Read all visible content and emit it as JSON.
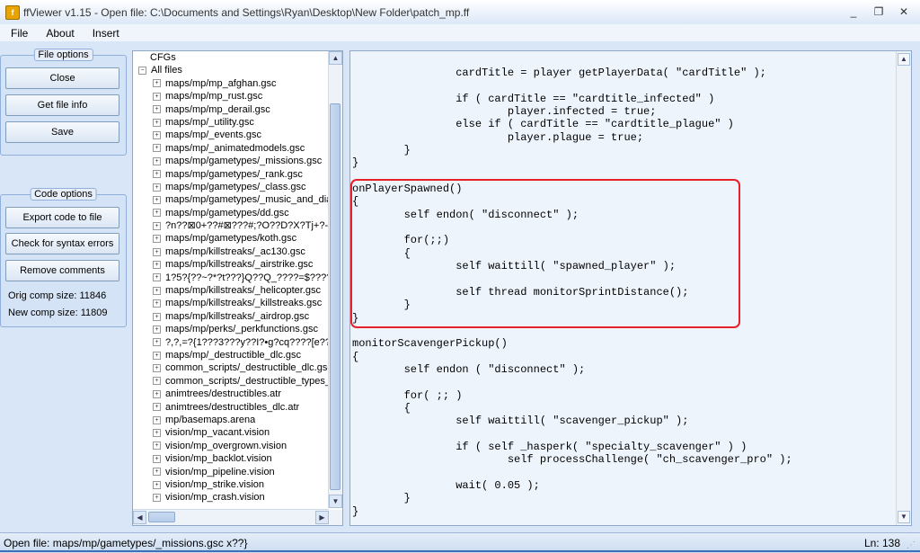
{
  "window": {
    "title": "ffViewer v1.15 - Open file: C:\\Documents and Settings\\Ryan\\Desktop\\New Folder\\patch_mp.ff",
    "minimize": "_",
    "restore": "❐",
    "close": "✕"
  },
  "menu": [
    "File",
    "About",
    "Insert"
  ],
  "file_options": {
    "title": "File options",
    "close": "Close",
    "get_info": "Get file info",
    "save": "Save"
  },
  "code_options": {
    "title": "Code options",
    "export": "Export code to file",
    "syntax": "Check for syntax errors",
    "remove_comments": "Remove comments",
    "orig_size": "Orig comp size: 11846",
    "new_size": "New comp size: 11809"
  },
  "tree": {
    "cfgs": "CFGs",
    "all_files": "All files",
    "items": [
      "maps/mp/mp_afghan.gsc",
      "maps/mp/mp_rust.gsc",
      "maps/mp/mp_derail.gsc",
      "maps/mp/_utility.gsc",
      "maps/mp/_events.gsc",
      "maps/mp/_animatedmodels.gsc",
      "maps/mp/gametypes/_missions.gsc",
      "maps/mp/gametypes/_rank.gsc",
      "maps/mp/gametypes/_class.gsc",
      "maps/mp/gametypes/_music_and_dia",
      "maps/mp/gametypes/dd.gsc",
      "?n??⊠0+??#⊠???#;?O??D?X?Tj+?-?k",
      "maps/mp/gametypes/koth.gsc",
      "maps/mp/killstreaks/_ac130.gsc",
      "maps/mp/killstreaks/_airstrike.gsc",
      "1?5?{??~?*?t???}Q??Q_????=$????",
      "maps/mp/killstreaks/_helicopter.gsc",
      "maps/mp/killstreaks/_killstreaks.gsc",
      "maps/mp/killstreaks/_airdrop.gsc",
      "maps/mp/perks/_perkfunctions.gsc",
      "?,?,=?{1???3???y??I?•g?cq????[e???",
      "maps/mp/_destructible_dlc.gsc",
      "common_scripts/_destructible_dlc.gsc",
      "common_scripts/_destructible_types_",
      "animtrees/destructibles.atr",
      "animtrees/destructibles_dlc.atr",
      "mp/basemaps.arena",
      "vision/mp_vacant.vision",
      "vision/mp_overgrown.vision",
      "vision/mp_backlot.vision",
      "vision/mp_pipeline.vision",
      "vision/mp_strike.vision",
      "vision/mp_crash.vision"
    ]
  },
  "code_text": "                cardTitle = player getPlayerData( \"cardTitle\" );\n\n                if ( cardTitle == \"cardtitle_infected\" )\n                        player.infected = true;\n                else if ( cardTitle == \"cardtitle_plague\" )\n                        player.plague = true;\n        }\n}\n\nonPlayerSpawned()\n{\n        self endon( \"disconnect\" );\n\n        for(;;)\n        {\n                self waittill( \"spawned_player\" );\n\n                self thread monitorSprintDistance();\n        }\n}\n\nmonitorScavengerPickup()\n{\n        self endon ( \"disconnect\" );\n\n        for( ;; )\n        {\n                self waittill( \"scavenger_pickup\" );\n\n                if ( self _hasperk( \"specialty_scavenger\" ) )\n                        self processChallenge( \"ch_scavenger_pro\" );\n\n                wait( 0.05 );\n        }\n}",
  "status": {
    "left": "Open file: maps/mp/gametypes/_missions.gsc  x??}",
    "right": "Ln: 138"
  },
  "colors": {
    "highlight_box": "#e8202a",
    "background": "#d9e6f7"
  }
}
